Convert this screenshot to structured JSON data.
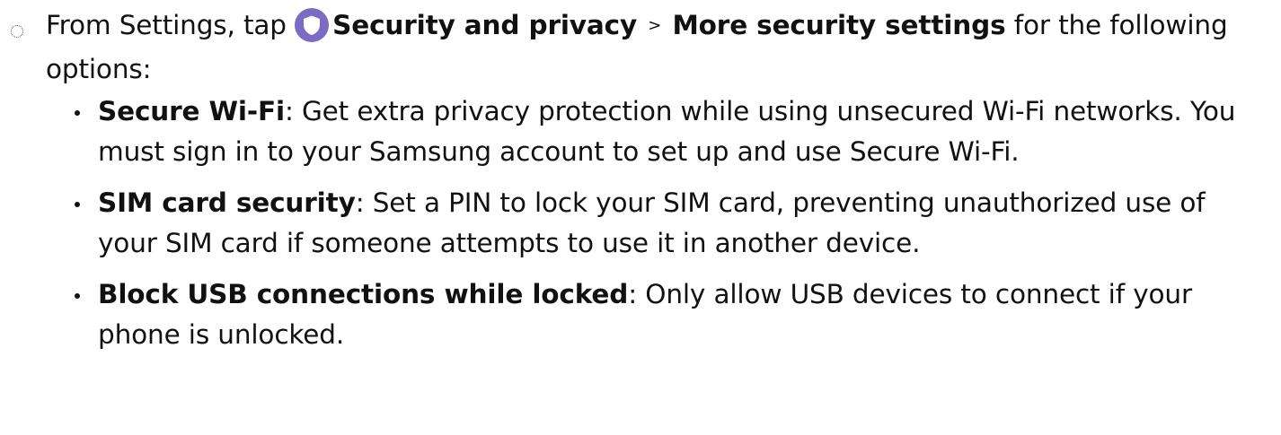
{
  "step": {
    "intro": "From Settings, tap",
    "menu_primary": "Security and privacy",
    "separator": ">",
    "menu_secondary": "More security settings",
    "outro": "for the following options:",
    "icon": "shield-icon",
    "icon_color": "#7c6bc4"
  },
  "options": [
    {
      "term": "Secure Wi-Fi",
      "description": "Get extra privacy protection while using unsecured Wi-Fi networks. You must sign in to your Samsung account to set up and use Secure Wi-Fi."
    },
    {
      "term": "SIM card security",
      "description": "Set a PIN to lock your SIM card, preventing unauthorized use of your SIM card if someone attempts to use it in another device."
    },
    {
      "term": "Block USB connections while locked",
      "description": "Only allow USB devices to connect if your phone is unlocked."
    }
  ]
}
